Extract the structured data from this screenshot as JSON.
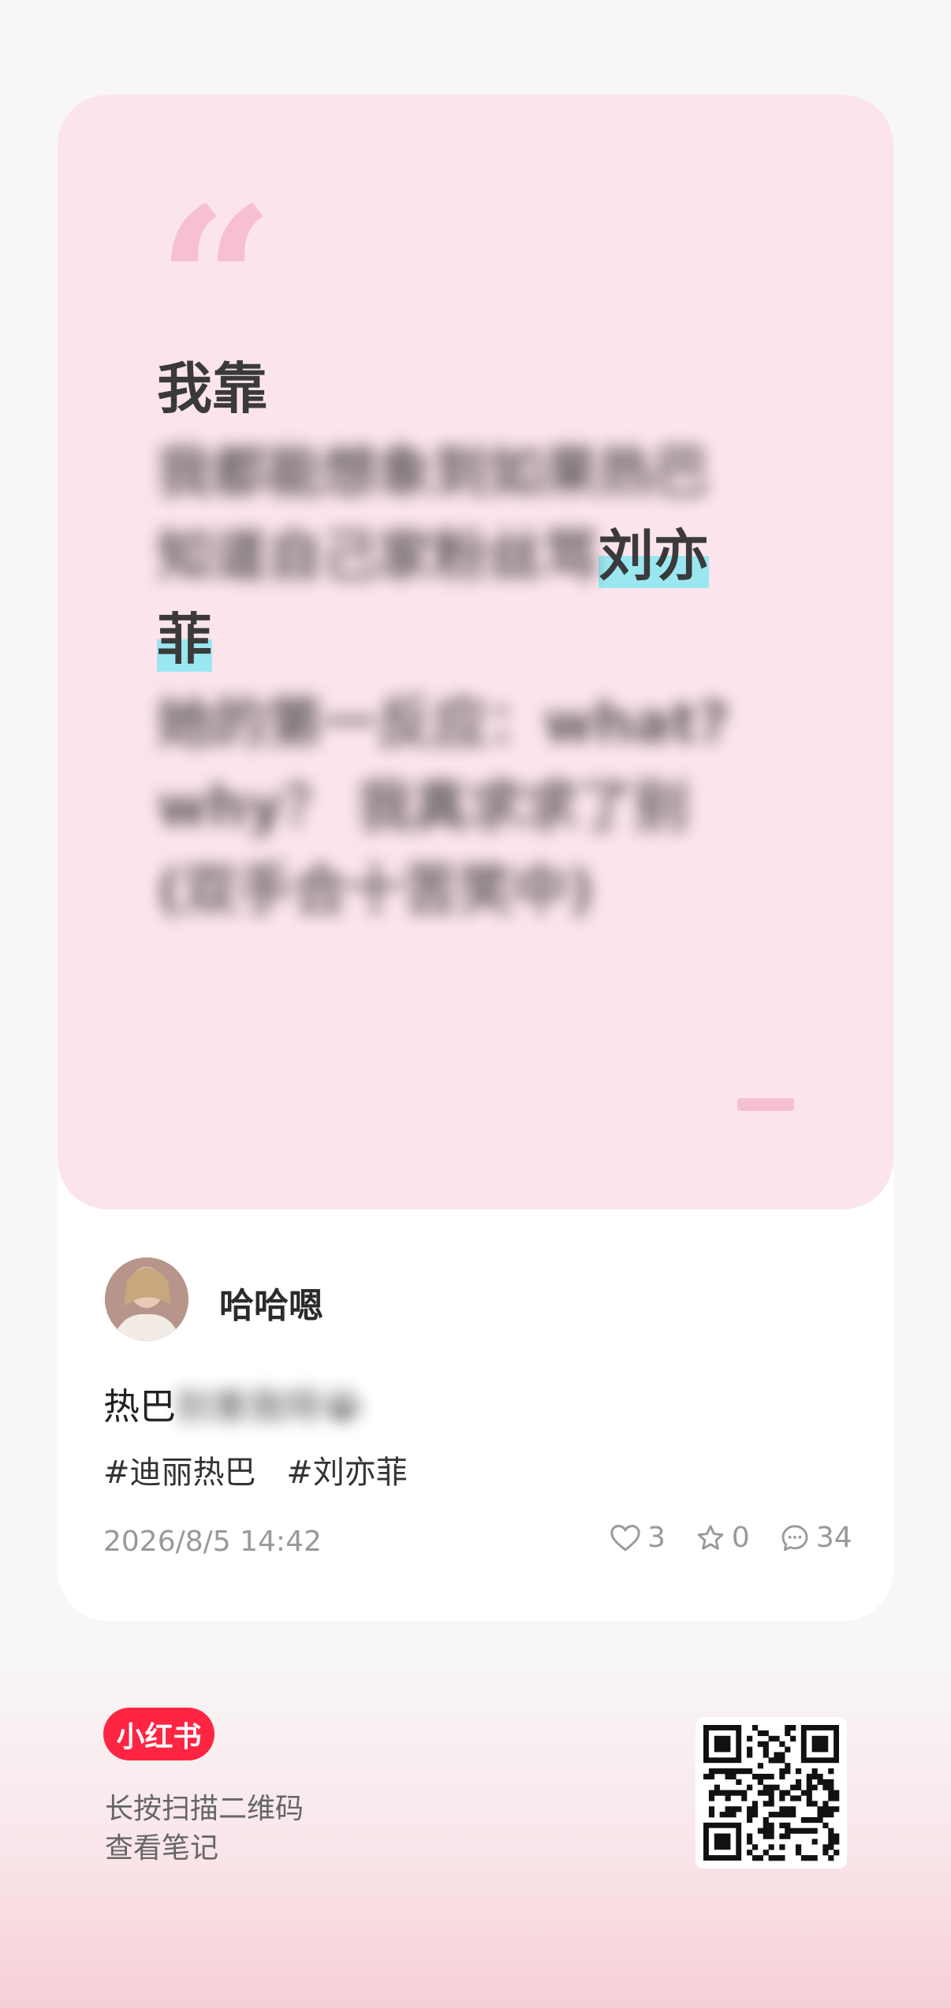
{
  "quote": {
    "lines": [
      {
        "text": "我靠",
        "blur": false
      },
      {
        "text": "我都能想象到如果热巴",
        "blur": true
      },
      {
        "text": "知道自己家粉丝骂",
        "blur": true,
        "tail": "刘亦"
      },
      {
        "text": "菲",
        "blur": false,
        "highlight": true
      },
      {
        "text": "她的第一反应：what?",
        "blur": true
      },
      {
        "text": "why？ 我真求求了别",
        "blur": true
      },
      {
        "text": "(双手合十苦笑中)",
        "blur": true
      }
    ]
  },
  "author": {
    "name": "哈哈嗯"
  },
  "note": {
    "title_visible": "热巴",
    "title_blurred": "别害我呀😭",
    "tags": [
      "#迪丽热巴",
      "#刘亦菲"
    ],
    "date": "2026/8/5 14:42",
    "likes": "3",
    "favorites": "0",
    "comments": "34"
  },
  "footer": {
    "logo": "小红书",
    "scan_line1": "长按扫描二维码",
    "scan_line2": "查看笔记"
  },
  "colors": {
    "brand": "#ff2442",
    "panel": "#fce4ec",
    "highlight": "#9ae7f2",
    "quote_mark": "#f7bfd3"
  }
}
